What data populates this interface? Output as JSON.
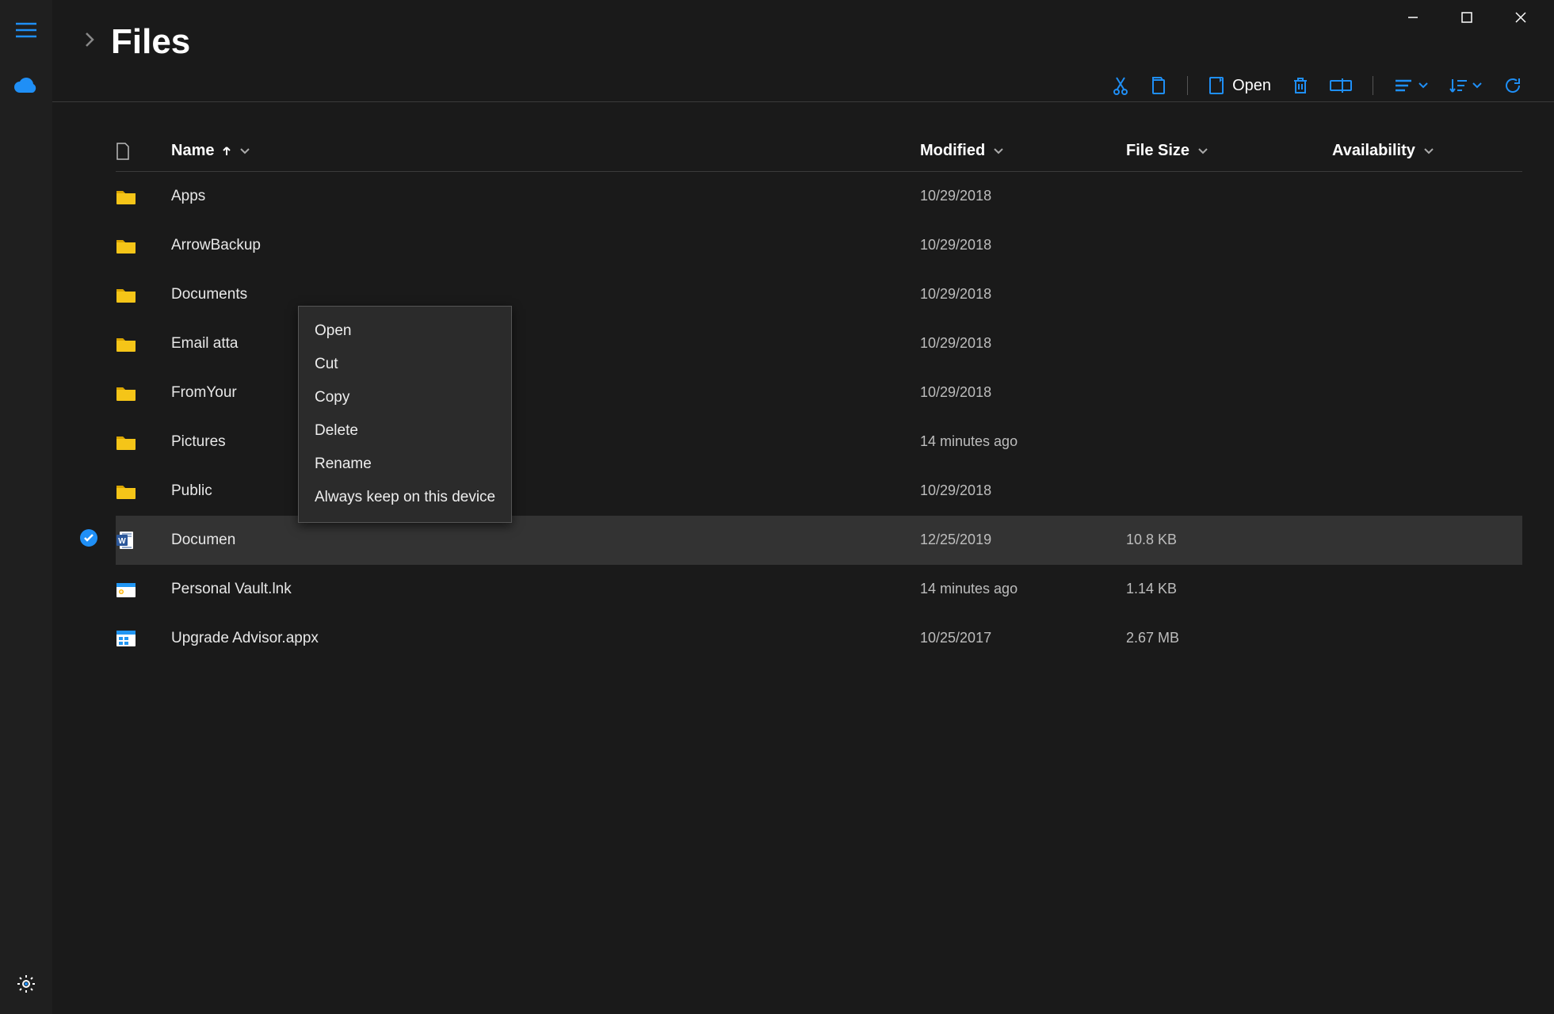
{
  "window_controls": {
    "minimize": "—",
    "maximize": "☐",
    "close": "✕"
  },
  "sidebar": {
    "hamburger": "hamburger",
    "cloud": "onedrive",
    "settings": "settings"
  },
  "header": {
    "title": "Files"
  },
  "toolbar": {
    "open_label": "Open"
  },
  "columns": {
    "name": "Name",
    "modified": "Modified",
    "size": "File Size",
    "availability": "Availability"
  },
  "rows": [
    {
      "type": "folder",
      "name": "Apps",
      "modified": "10/29/2018",
      "size": "",
      "availability": "",
      "selected": false
    },
    {
      "type": "folder",
      "name": "ArrowBackup",
      "modified": "10/29/2018",
      "size": "",
      "availability": "",
      "selected": false
    },
    {
      "type": "folder",
      "name": "Documents",
      "modified": "10/29/2018",
      "size": "",
      "availability": "",
      "selected": false
    },
    {
      "type": "folder",
      "name": "Email atta",
      "modified": "10/29/2018",
      "size": "",
      "availability": "",
      "selected": false
    },
    {
      "type": "folder",
      "name": "FromYour",
      "modified": "10/29/2018",
      "size": "",
      "availability": "",
      "selected": false
    },
    {
      "type": "folder",
      "name": "Pictures",
      "modified": "14 minutes ago",
      "size": "",
      "availability": "",
      "selected": false
    },
    {
      "type": "folder",
      "name": "Public",
      "modified": "10/29/2018",
      "size": "",
      "availability": "",
      "selected": false
    },
    {
      "type": "word",
      "name": "Documen",
      "modified": "12/25/2019",
      "size": "10.8 KB",
      "availability": "",
      "selected": true
    },
    {
      "type": "vault",
      "name": "Personal Vault.lnk",
      "modified": "14 minutes ago",
      "size": "1.14 KB",
      "availability": "",
      "selected": false
    },
    {
      "type": "appx",
      "name": "Upgrade Advisor.appx",
      "modified": "10/25/2017",
      "size": "2.67 MB",
      "availability": "",
      "selected": false
    }
  ],
  "context_menu": {
    "items": [
      "Open",
      "Cut",
      "Copy",
      "Delete",
      "Rename",
      "Always keep on this device"
    ]
  },
  "accent": "#1f8ff6",
  "folder_color": "#f5c518"
}
